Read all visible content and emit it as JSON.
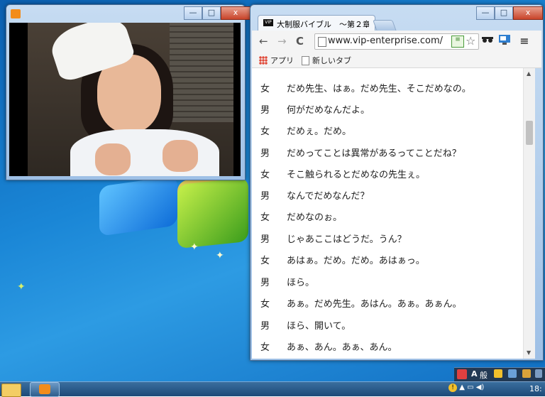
{
  "player": {
    "title_icon": "media-player-icon",
    "buttons": {
      "minimize": "—",
      "maximize": "□",
      "close": "x"
    }
  },
  "browser": {
    "tab_title": "大制服バイブル　～第２章",
    "tab_favicon": "VIP",
    "url": "www.vip-enterprise.com/",
    "buttons": {
      "minimize": "—",
      "maximize": "□",
      "close": "x"
    },
    "nav": {
      "back": "←",
      "forward": "→",
      "reload": "C"
    },
    "bookmarks": [
      {
        "label": "アプリ",
        "icon": "apps-grid-icon"
      },
      {
        "label": "新しいタブ",
        "icon": "document-icon"
      }
    ],
    "dialogue": [
      {
        "speaker": "女",
        "text": "だめ先生、はぁ。だめ先生、そこだめなの。"
      },
      {
        "speaker": "男",
        "text": "何がだめなんだよ。"
      },
      {
        "speaker": "女",
        "text": "だめぇ。だめ。"
      },
      {
        "speaker": "男",
        "text": "だめってことは異常があるってことだね？"
      },
      {
        "speaker": "女",
        "text": "そこ触られるとだめなの先生ぇ。"
      },
      {
        "speaker": "男",
        "text": "なんでだめなんだ？"
      },
      {
        "speaker": "女",
        "text": "だめなのぉ。"
      },
      {
        "speaker": "男",
        "text": "じゃあここはどうだ。うん？"
      },
      {
        "speaker": "女",
        "text": "あはぁ。だめ。だめ。あはぁっ。"
      },
      {
        "speaker": "男",
        "text": "ほら。"
      },
      {
        "speaker": "女",
        "text": "あぁ。だめ先生。あはん。あぁ。あぁん。"
      },
      {
        "speaker": "男",
        "text": "ほら、開いて。"
      },
      {
        "speaker": "女",
        "text": "あぁ、あん。あぁ、あん。"
      }
    ]
  },
  "taskbar": {
    "language": "A",
    "ime": "般",
    "clock": "18:"
  },
  "colors": {
    "accent_orange": "#f28c1b",
    "taskbar": "#1c4a78"
  }
}
